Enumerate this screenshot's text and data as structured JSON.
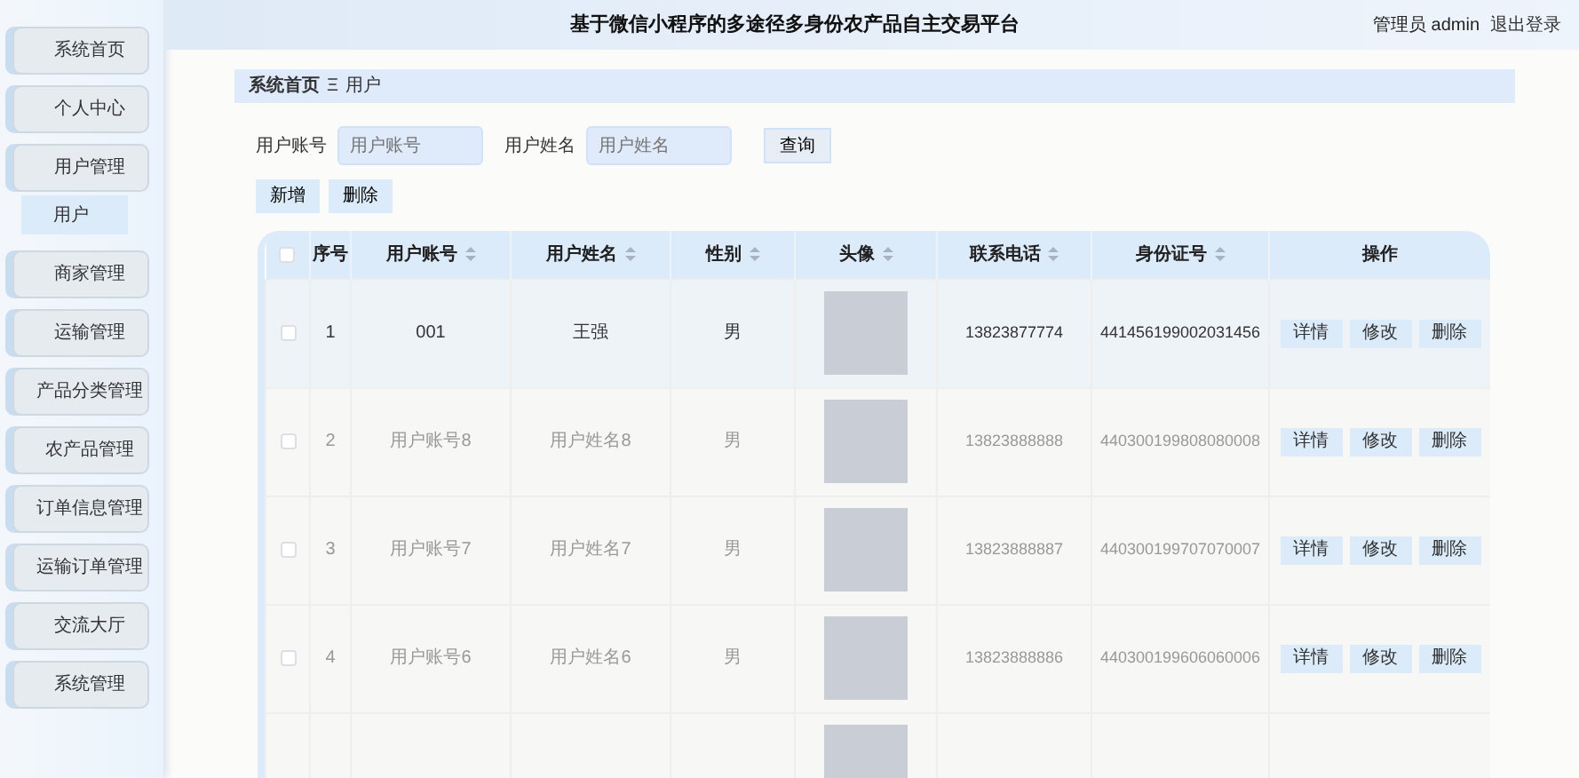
{
  "header": {
    "title": "基于微信小程序的多途径多身份农产品自主交易平台",
    "user": "管理员 admin",
    "logout": "退出登录"
  },
  "sidebar": {
    "items": [
      {
        "label": "系统首页"
      },
      {
        "label": "个人中心"
      },
      {
        "label": "用户管理",
        "children": [
          {
            "label": "用户",
            "selected": true
          }
        ]
      },
      {
        "label": "商家管理"
      },
      {
        "label": "运输管理"
      },
      {
        "label": "产品分类管理"
      },
      {
        "label": "农产品管理"
      },
      {
        "label": "订单信息管理"
      },
      {
        "label": "运输订单管理"
      },
      {
        "label": "交流大厅"
      },
      {
        "label": "系统管理"
      }
    ]
  },
  "breadcrumb": {
    "items": [
      "系统首页",
      "用户"
    ],
    "separator": "Ξ"
  },
  "search": {
    "fields": [
      {
        "label": "用户账号",
        "placeholder": "用户账号"
      },
      {
        "label": "用户姓名",
        "placeholder": "用户姓名"
      }
    ],
    "button": "查询"
  },
  "actions": [
    "新增",
    "删除"
  ],
  "table": {
    "columns": [
      {
        "label": "序号",
        "sortable": false
      },
      {
        "label": "用户账号",
        "sortable": true
      },
      {
        "label": "用户姓名",
        "sortable": true
      },
      {
        "label": "性别",
        "sortable": true
      },
      {
        "label": "头像",
        "sortable": true
      },
      {
        "label": "联系电话",
        "sortable": true
      },
      {
        "label": "身份证号",
        "sortable": true
      },
      {
        "label": "操作",
        "sortable": false
      }
    ],
    "header_checked": false,
    "rows": [
      {
        "index": "1",
        "account": "001",
        "name": "王强",
        "gender": "男",
        "phone": "13823877774",
        "id_number": "441456199002031456",
        "checked": false,
        "hovered": true,
        "buttons": [
          "详情",
          "修改",
          "删除"
        ]
      },
      {
        "index": "2",
        "account": "用户账号8",
        "name": "用户姓名8",
        "gender": "男",
        "phone": "13823888888",
        "id_number": "440300199808080008",
        "checked": false,
        "hovered": false,
        "buttons": [
          "详情",
          "修改",
          "删除"
        ]
      },
      {
        "index": "3",
        "account": "用户账号7",
        "name": "用户姓名7",
        "gender": "男",
        "phone": "13823888887",
        "id_number": "440300199707070007",
        "checked": false,
        "hovered": false,
        "buttons": [
          "详情",
          "修改",
          "删除"
        ]
      },
      {
        "index": "4",
        "account": "用户账号6",
        "name": "用户姓名6",
        "gender": "男",
        "phone": "13823888886",
        "id_number": "440300199606060006",
        "checked": false,
        "hovered": false,
        "buttons": [
          "详情",
          "修改",
          "删除"
        ]
      }
    ]
  }
}
